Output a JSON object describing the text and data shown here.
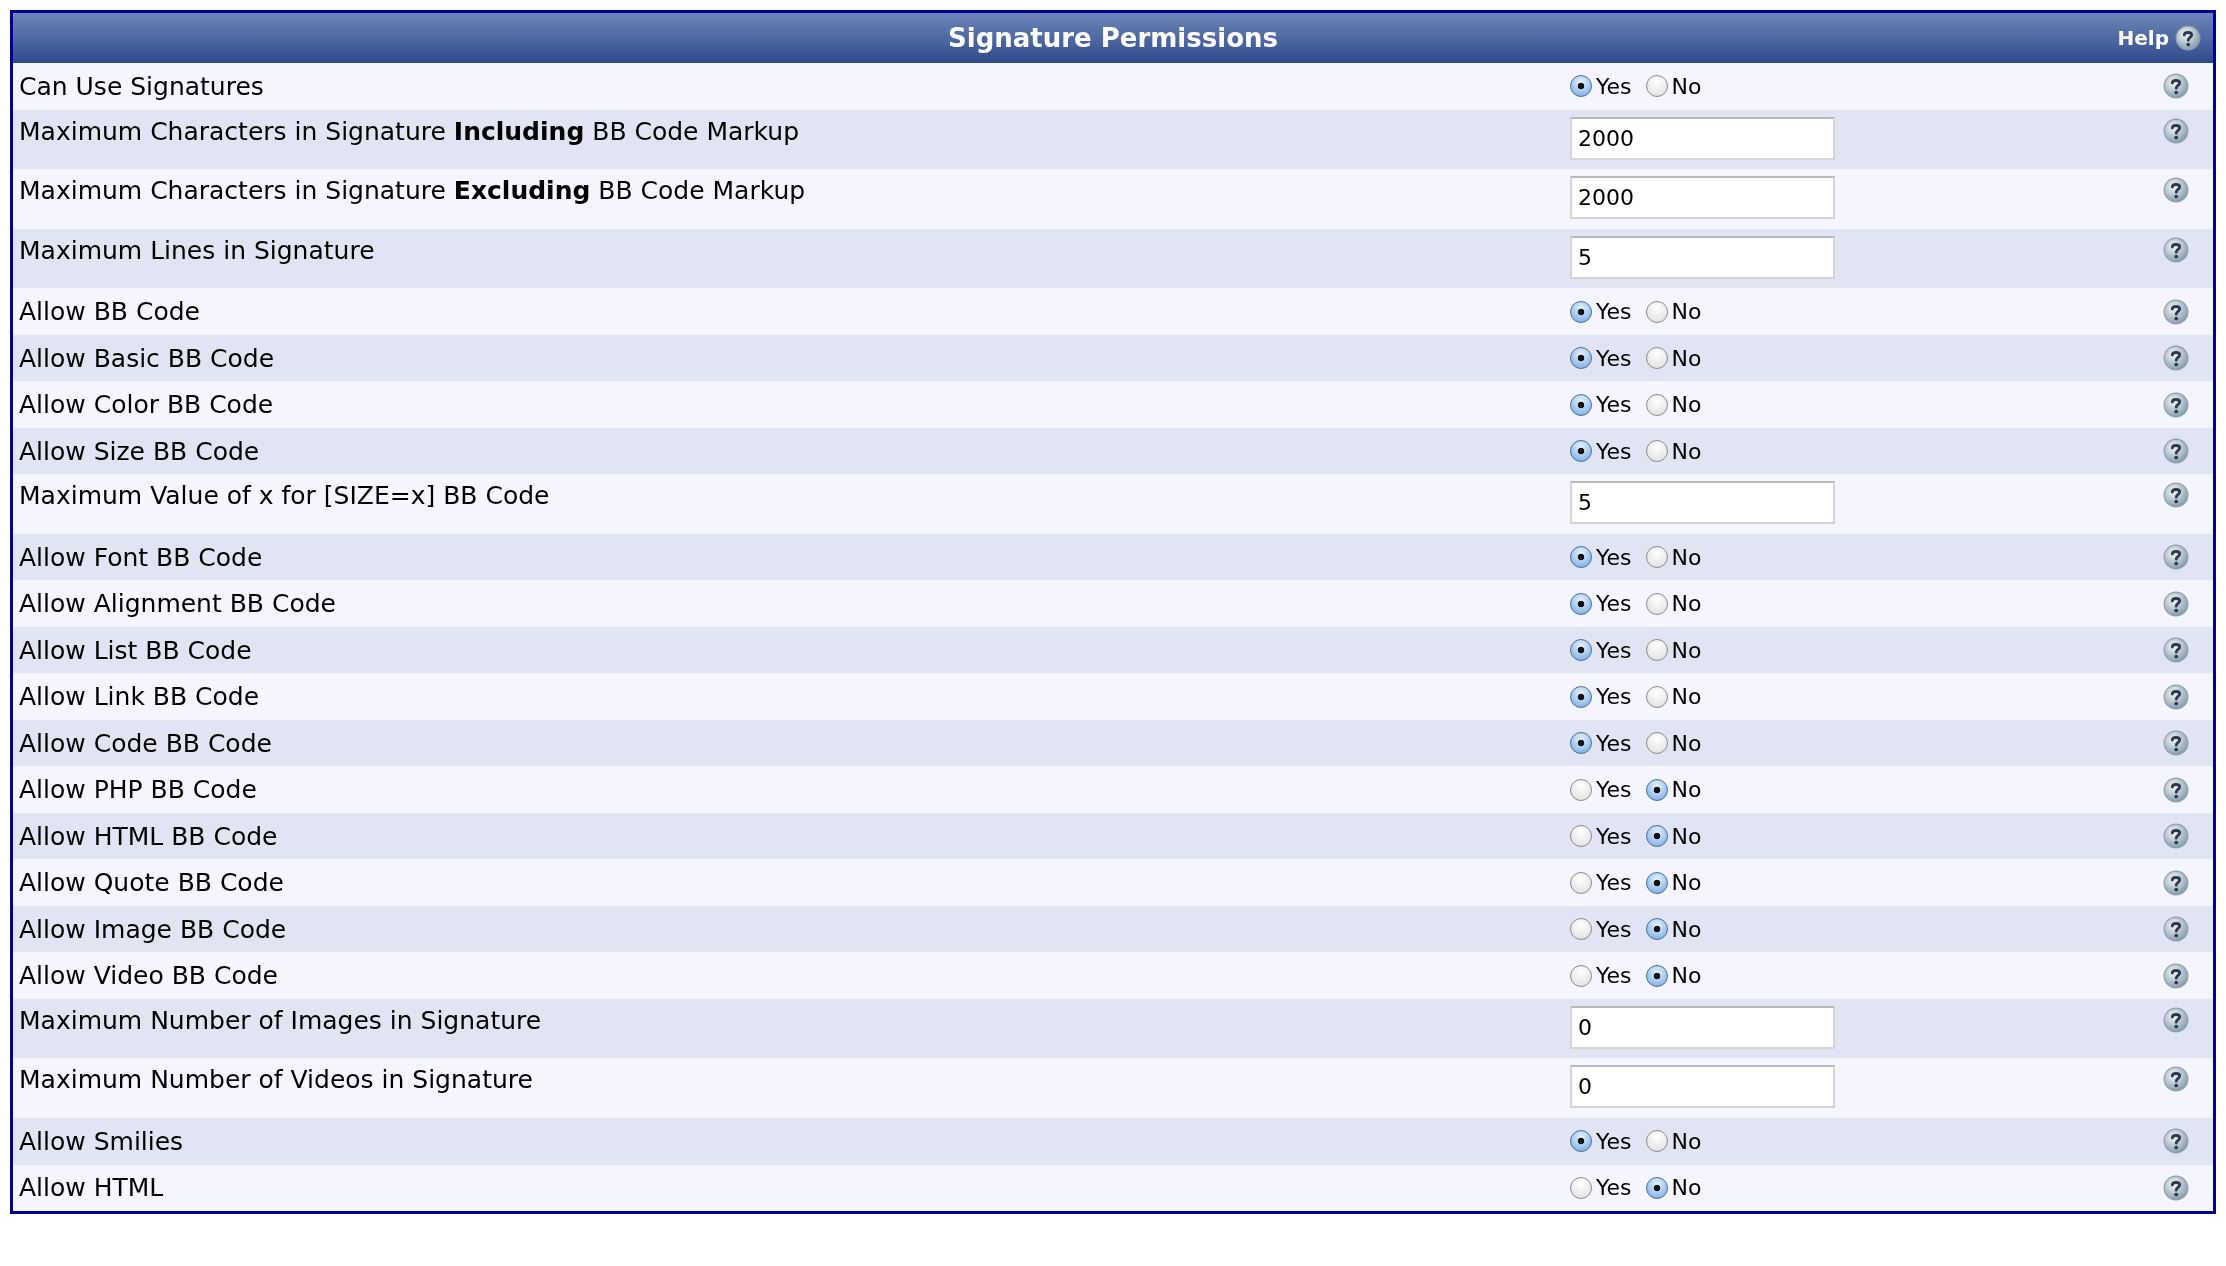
{
  "header": {
    "title": "Signature Permissions",
    "help": "Help"
  },
  "rows": [
    {
      "kind": "yesno",
      "label": "Can Use Signatures",
      "options": [
        {
          "label": "Yes",
          "selected": true
        },
        {
          "label": "No",
          "selected": false
        }
      ]
    },
    {
      "kind": "text",
      "label": "Maximum Characters in Signature **Including** BB Code Markup",
      "value": "2000"
    },
    {
      "kind": "text",
      "label": "Maximum Characters in Signature **Excluding** BB Code Markup",
      "value": "2000"
    },
    {
      "kind": "text",
      "label": "Maximum Lines in Signature",
      "value": "5"
    },
    {
      "kind": "yesno",
      "label": "Allow BB Code",
      "options": [
        {
          "label": "Yes",
          "selected": true
        },
        {
          "label": "No",
          "selected": false
        }
      ]
    },
    {
      "kind": "yesno",
      "label": "Allow Basic BB Code",
      "options": [
        {
          "label": "Yes",
          "selected": true
        },
        {
          "label": "No",
          "selected": false
        }
      ]
    },
    {
      "kind": "yesno",
      "label": "Allow Color BB Code",
      "options": [
        {
          "label": "Yes",
          "selected": true
        },
        {
          "label": "No",
          "selected": false
        }
      ]
    },
    {
      "kind": "yesno",
      "label": "Allow Size BB Code",
      "options": [
        {
          "label": "Yes",
          "selected": true
        },
        {
          "label": "No",
          "selected": false
        }
      ]
    },
    {
      "kind": "text",
      "label": "Maximum Value of x for [SIZE=x] BB Code",
      "value": "5"
    },
    {
      "kind": "yesno",
      "label": "Allow Font BB Code",
      "options": [
        {
          "label": "Yes",
          "selected": true
        },
        {
          "label": "No",
          "selected": false
        }
      ]
    },
    {
      "kind": "yesno",
      "label": "Allow Alignment BB Code",
      "options": [
        {
          "label": "Yes",
          "selected": true
        },
        {
          "label": "No",
          "selected": false
        }
      ]
    },
    {
      "kind": "yesno",
      "label": "Allow List BB Code",
      "options": [
        {
          "label": "Yes",
          "selected": true
        },
        {
          "label": "No",
          "selected": false
        }
      ]
    },
    {
      "kind": "yesno",
      "label": "Allow Link BB Code",
      "options": [
        {
          "label": "Yes",
          "selected": true
        },
        {
          "label": "No",
          "selected": false
        }
      ]
    },
    {
      "kind": "yesno",
      "label": "Allow Code BB Code",
      "options": [
        {
          "label": "Yes",
          "selected": true
        },
        {
          "label": "No",
          "selected": false
        }
      ]
    },
    {
      "kind": "yesno",
      "label": "Allow PHP BB Code",
      "options": [
        {
          "label": "Yes",
          "selected": false
        },
        {
          "label": "No",
          "selected": true
        }
      ]
    },
    {
      "kind": "yesno",
      "label": "Allow HTML BB Code",
      "options": [
        {
          "label": "Yes",
          "selected": false
        },
        {
          "label": "No",
          "selected": true
        }
      ]
    },
    {
      "kind": "yesno",
      "label": "Allow Quote BB Code",
      "options": [
        {
          "label": "Yes",
          "selected": false
        },
        {
          "label": "No",
          "selected": true
        }
      ]
    },
    {
      "kind": "yesno",
      "label": "Allow Image BB Code",
      "options": [
        {
          "label": "Yes",
          "selected": false
        },
        {
          "label": "No",
          "selected": true
        }
      ]
    },
    {
      "kind": "yesno",
      "label": "Allow Video BB Code",
      "options": [
        {
          "label": "Yes",
          "selected": false
        },
        {
          "label": "No",
          "selected": true
        }
      ]
    },
    {
      "kind": "text",
      "label": "Maximum Number of Images in Signature",
      "value": "0"
    },
    {
      "kind": "text",
      "label": "Maximum Number of Videos in Signature",
      "value": "0"
    },
    {
      "kind": "yesno",
      "label": "Allow Smilies",
      "options": [
        {
          "label": "Yes",
          "selected": true
        },
        {
          "label": "No",
          "selected": false
        }
      ]
    },
    {
      "kind": "yesno",
      "label": "Allow HTML",
      "options": [
        {
          "label": "Yes",
          "selected": false
        },
        {
          "label": "No",
          "selected": true
        }
      ]
    }
  ]
}
